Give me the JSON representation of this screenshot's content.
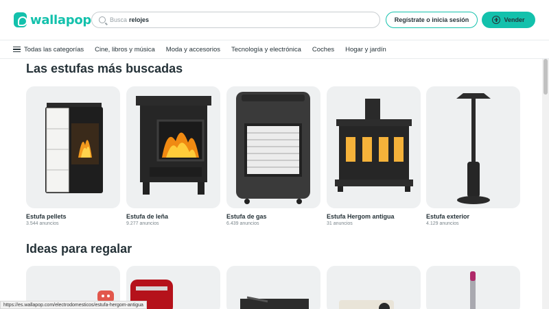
{
  "header": {
    "logo_text": "wallapop",
    "search_placeholder": "Busca",
    "search_term": "relojes",
    "login_label": "Regístrate o inicia sesión",
    "sell_label": "Vender"
  },
  "categories": {
    "all_label": "Todas las categorías",
    "items": [
      "Cine, libros y música",
      "Moda y accesorios",
      "Tecnología y electrónica",
      "Coches",
      "Hogar y jardín"
    ]
  },
  "sections": [
    {
      "title": "Las estufas más buscadas",
      "cards": [
        {
          "title": "Estufa pellets",
          "count": "3.544 anuncios",
          "icon": "pellet-stove-image"
        },
        {
          "title": "Estufa de leña",
          "count": "9.277 anuncios",
          "icon": "wood-stove-image"
        },
        {
          "title": "Estufa de gas",
          "count": "6.439 anuncios",
          "icon": "gas-heater-image"
        },
        {
          "title": "Estufa Hergom antigua",
          "count": "31 anuncios",
          "icon": "antique-stove-image"
        },
        {
          "title": "Estufa exterior",
          "count": "4.129 anuncios",
          "icon": "patio-heater-image"
        }
      ]
    },
    {
      "title": "Ideas para regalar",
      "cards": [
        {
          "icon": "gift-idea-image"
        },
        {
          "icon": "stand-mixer-image"
        },
        {
          "icon": "turntable-image"
        },
        {
          "icon": "camera-image"
        },
        {
          "icon": "hair-styler-image"
        }
      ]
    }
  ],
  "status_url": "https://es.wallapop.com/electrodomesticos/estufa-hergom-antigua",
  "colors": {
    "brand": "#13c1ac",
    "text": "#253238",
    "card_bg": "#eef0f1"
  }
}
